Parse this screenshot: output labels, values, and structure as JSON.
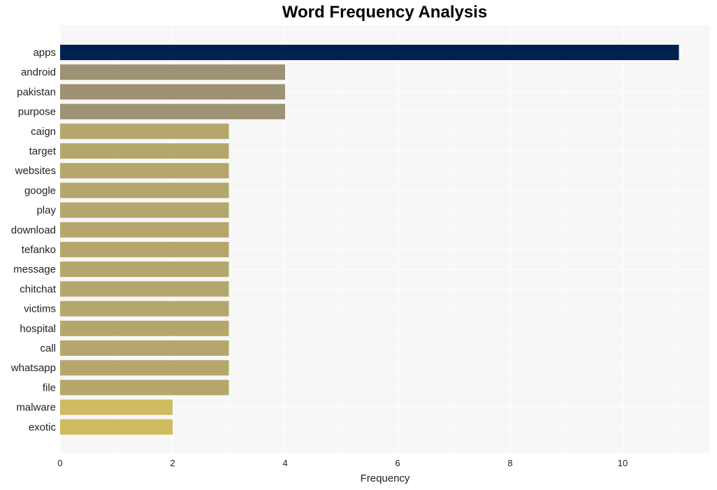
{
  "chart_data": {
    "type": "bar",
    "orientation": "horizontal",
    "title": "Word Frequency Analysis",
    "xlabel": "Frequency",
    "ylabel": "",
    "xlim": [
      0,
      11.55
    ],
    "xticks": [
      0,
      2,
      4,
      6,
      8,
      10
    ],
    "grid": true,
    "categories": [
      "apps",
      "android",
      "pakistan",
      "purpose",
      "caign",
      "target",
      "websites",
      "google",
      "play",
      "download",
      "tefanko",
      "message",
      "chitchat",
      "victims",
      "hospital",
      "call",
      "whatsapp",
      "file",
      "malware",
      "exotic"
    ],
    "values": [
      11,
      4,
      4,
      4,
      3,
      3,
      3,
      3,
      3,
      3,
      3,
      3,
      3,
      3,
      3,
      3,
      3,
      3,
      2,
      2
    ],
    "colors": {
      "11": "#00224e",
      "4": "#9d9274",
      "3": "#b5a76c",
      "2": "#cfbb60"
    },
    "background": "#f7f7f7"
  }
}
